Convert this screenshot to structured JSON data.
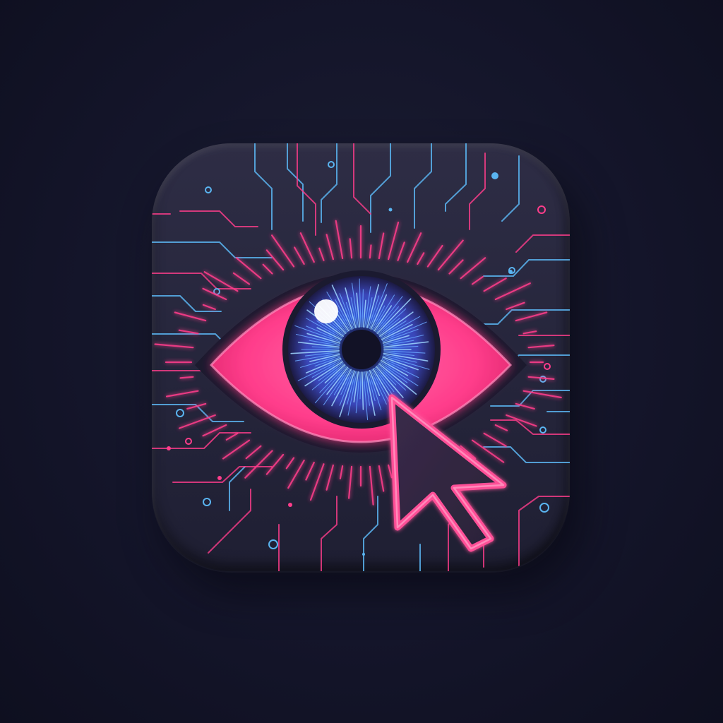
{
  "icon": {
    "name": "eye-cursor-app-icon",
    "motif": [
      "circuit-traces-icon",
      "eye-icon",
      "cursor-arrow-icon"
    ]
  },
  "colors": {
    "background": "#14152a",
    "tile": "#2a2a40",
    "neon_pink": "#ff3d8b",
    "neon_blue": "#5ab4f0",
    "iris_blue": "#3f63d8",
    "pupil": "#141428"
  }
}
